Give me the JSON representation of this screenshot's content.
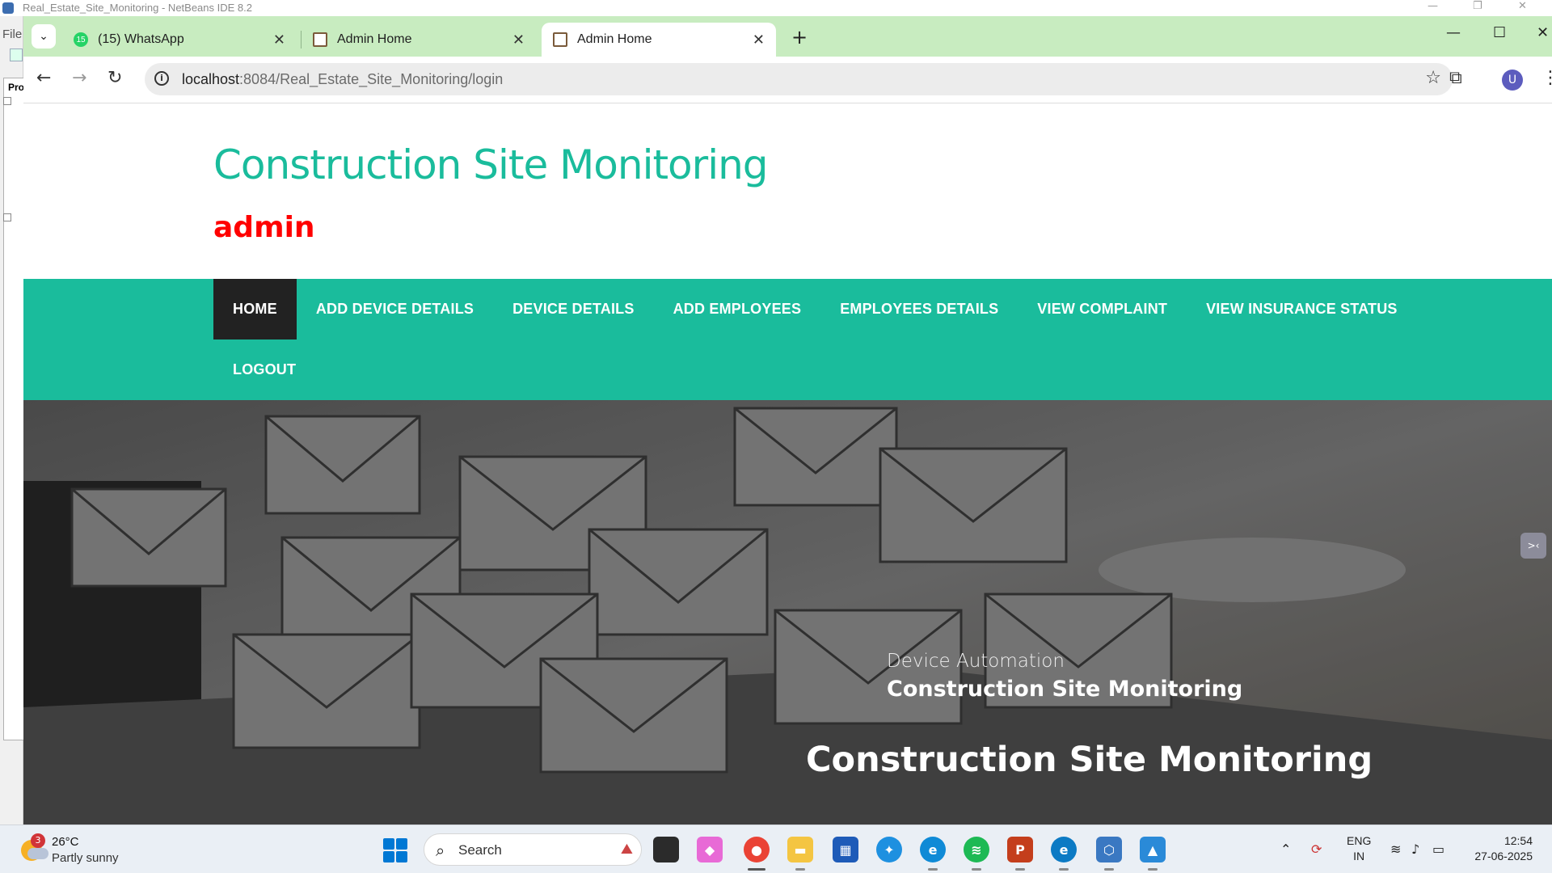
{
  "ide": {
    "title": "Real_Estate_Site_Monitoring - NetBeans IDE 8.2",
    "menu_file": "File",
    "projects_tab": "Pro"
  },
  "browser": {
    "tabs": [
      {
        "label": "(15) WhatsApp",
        "badge": "15",
        "icon": "whatsapp-icon",
        "active": false
      },
      {
        "label": "Admin Home",
        "icon": "image-favicon-icon",
        "active": false
      },
      {
        "label": "Admin Home",
        "icon": "image-favicon-icon",
        "active": true
      }
    ],
    "new_tab": "+",
    "url_host": "localhost",
    "url_path": ":8084/Real_Estate_Site_Monitoring/login",
    "profile_initial": "U"
  },
  "page": {
    "site_title": "Construction Site Monitoring",
    "user_label": "admin",
    "nav": [
      {
        "label": "HOME",
        "active": true
      },
      {
        "label": "ADD DEVICE DETAILS"
      },
      {
        "label": "DEVICE DETAILS"
      },
      {
        "label": "ADD EMPLOYEES"
      },
      {
        "label": "EMPLOYEES DETAILS"
      },
      {
        "label": "VIEW COMPLAINT"
      },
      {
        "label": "VIEW INSURANCE STATUS"
      },
      {
        "label": "LOGOUT"
      }
    ],
    "hero": {
      "subtitle": "Device Automation",
      "subtitle_bold": "Construction Site Monitoring",
      "heading": "Construction Site Monitoring"
    }
  },
  "taskbar": {
    "weather_badge": "3",
    "temperature": "26°C",
    "condition": "Partly sunny",
    "search_placeholder": "Search",
    "language": "ENG",
    "region": "IN",
    "time": "12:54",
    "date": "27-06-2025"
  },
  "colors": {
    "accent": "#1abc9c",
    "user_label": "#ff0000",
    "nav_active": "#222222",
    "tabstrip": "#c8ecc0"
  }
}
